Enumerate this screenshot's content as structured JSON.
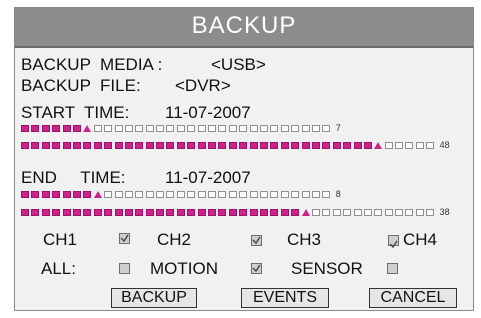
{
  "title": "BACKUP",
  "media": {
    "label": "BACKUP  MEDIA :",
    "value": "<USB>"
  },
  "file": {
    "label": "BACKUP  FILE:",
    "value": "<DVR>"
  },
  "start": {
    "label": "START  TIME:",
    "date": "11-07-2007",
    "hour": "7",
    "minute": "48"
  },
  "end": {
    "label": "END     TIME:",
    "date": "11-07-2007",
    "hour": "8",
    "minute": "38"
  },
  "channels": [
    {
      "label": "CH1",
      "checked": true
    },
    {
      "label": "CH2",
      "checked": true
    },
    {
      "label": "CH3",
      "checked": true
    },
    {
      "label": "CH4",
      "checked": true
    }
  ],
  "filters": [
    {
      "label": "ALL:",
      "checked": false
    },
    {
      "label": "MOTION",
      "checked": true
    },
    {
      "label": "SENSOR",
      "checked": false
    }
  ],
  "buttons": {
    "backup": "BACKUP",
    "events": "EVENTS",
    "cancel": "CANCEL"
  },
  "colors": {
    "title_bar": "#8c8c8c",
    "filled_cell": "#d0208a",
    "background": "#f1f1f1"
  }
}
